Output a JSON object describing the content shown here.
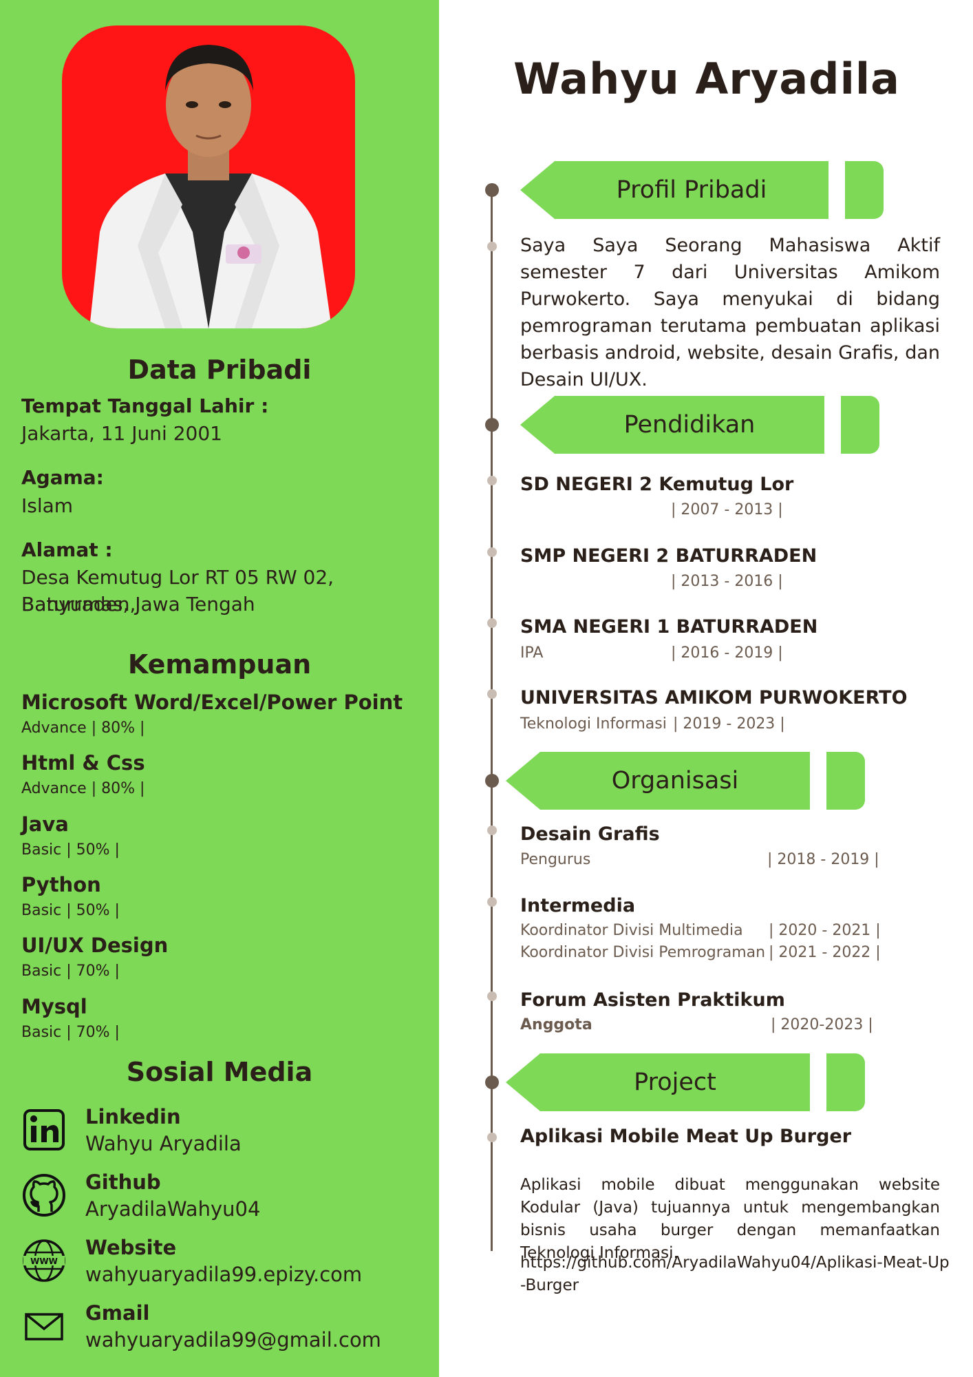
{
  "name": "Wahyu Aryadila",
  "colors": {
    "accent_green": "#7ed957",
    "photo_bg": "#ff1515",
    "text_dark": "#2a2019",
    "timeline": "#6b5a4e"
  },
  "personal": {
    "heading": "Data Pribadi",
    "birth_label": "Tempat Tanggal Lahir :",
    "birth_value": "Jakarta, 11 Juni 2001",
    "religion_label": "Agama:",
    "religion_value": "Islam",
    "address_label": "Alamat :",
    "address_line1": "Desa Kemutug Lor RT 05 RW 02, Baturraden,",
    "address_line2": "Banyumas, Jawa Tengah"
  },
  "skills": {
    "heading": "Kemampuan",
    "items": [
      {
        "name": "Microsoft Word/Excel/Power Point",
        "level": "Advance | 80% |"
      },
      {
        "name": "Html & Css",
        "level": "Advance | 80% |"
      },
      {
        "name": "Java",
        "level": "Basic | 50% |"
      },
      {
        "name": "Python",
        "level": "Basic | 50% |"
      },
      {
        "name": "UI/UX Design",
        "level": "Basic | 70% |"
      },
      {
        "name": "Mysql",
        "level": "Basic | 70% |"
      }
    ]
  },
  "social": {
    "heading": "Sosial Media",
    "items": [
      {
        "icon": "linkedin-icon",
        "label": "Linkedin",
        "value": "Wahyu Aryadila"
      },
      {
        "icon": "github-icon",
        "label": "Github",
        "value": "AryadilaWahyu04"
      },
      {
        "icon": "globe-www-icon",
        "label": "Website",
        "value": "wahyuaryadila99.epizy.com"
      },
      {
        "icon": "mail-icon",
        "label": "Gmail",
        "value": "wahyuaryadila99@gmail.com"
      }
    ]
  },
  "profile": {
    "heading": "Profil Pribadi",
    "text": "Saya Saya Seorang Mahasiswa Aktif semester 7 dari Universitas Amikom Purwokerto. Saya menyukai di bidang pemrograman terutama pembuatan aplikasi berbasis android, website, desain Grafis, dan Desain UI/UX."
  },
  "education": {
    "heading": "Pendidikan",
    "items": [
      {
        "school": "SD NEGERI 2 Kemutug Lor",
        "detail": "",
        "years": "| 2007 - 2013 |"
      },
      {
        "school": "SMP NEGERI 2 BATURRADEN",
        "detail": "",
        "years": "| 2013 - 2016 |"
      },
      {
        "school": "SMA NEGERI 1 BATURRADEN",
        "detail": "IPA",
        "years": "| 2016 - 2019 |"
      },
      {
        "school": "UNIVERSITAS AMIKOM PURWOKERTO",
        "detail": "Teknologi Informasi",
        "years": "| 2019 - 2023 |"
      }
    ]
  },
  "organization": {
    "heading": "Organisasi",
    "items": [
      {
        "name": "Desain Grafis",
        "roles": [
          {
            "role": "Pengurus",
            "years": "| 2018 - 2019 |"
          }
        ]
      },
      {
        "name": "Intermedia",
        "roles": [
          {
            "role": "Koordinator Divisi Multimedia",
            "years": "| 2020 - 2021 |"
          },
          {
            "role": "Koordinator Divisi Pemrograman",
            "years": "| 2021 - 2022 |"
          }
        ]
      },
      {
        "name": "Forum Asisten Praktikum",
        "roles": [
          {
            "role": "Anggota",
            "years": "| 2020-2023 |"
          }
        ]
      }
    ]
  },
  "project": {
    "heading": "Project",
    "title": "Aplikasi Mobile Meat Up Burger",
    "description": "Aplikasi mobile dibuat menggunakan website Kodular (Java) tujuannya untuk mengembangkan bisnis usaha burger dengan memanfaatkan Teknologi Informasi.",
    "link": "https://github.com/AryadilaWahyu04/Aplikasi-Meat-Up-Burger"
  }
}
